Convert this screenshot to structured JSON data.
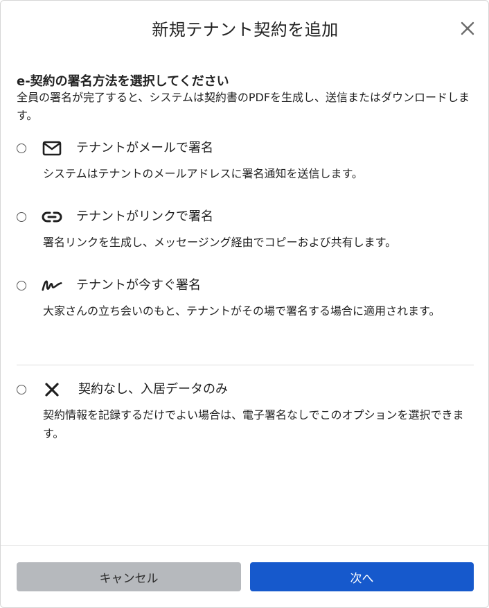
{
  "dialog": {
    "title": "新規テナント契約を追加"
  },
  "section": {
    "title": "e-契約の署名方法を選択してください",
    "description": "全員の署名が完了すると、システムは契約書のPDFを生成し、送信またはダウンロードします。"
  },
  "options": [
    {
      "icon": "mail-icon",
      "label": "テナントがメールで署名",
      "description": "システムはテナントのメールアドレスに署名通知を送信します。"
    },
    {
      "icon": "link-icon",
      "label": "テナントがリンクで署名",
      "description": "署名リンクを生成し、メッセージング経由でコピーおよび共有します。"
    },
    {
      "icon": "signature-icon",
      "label": "テナントが今すぐ署名",
      "description": "大家さんの立ち会いのもと、テナントがその場で署名する場合に適用されます。"
    },
    {
      "icon": "x-icon",
      "label": "契約なし、入居データのみ",
      "description": "契約情報を記録するだけでよい場合は、電子署名なしでこのオプションを選択できます。"
    }
  ],
  "footer": {
    "cancel_label": "キャンセル",
    "next_label": "次へ"
  },
  "colors": {
    "primary": "#1659cc",
    "cancel_bg": "#b6b9bd"
  }
}
